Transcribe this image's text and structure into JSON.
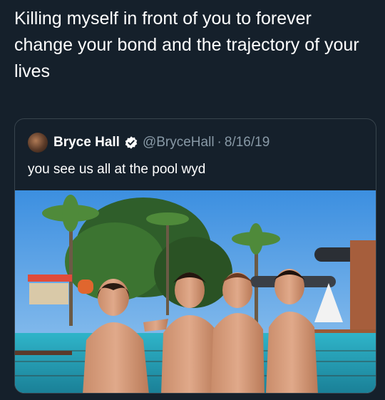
{
  "tweet": {
    "text": "Killing myself in front of you to forever change your bond and the trajectory of your lives"
  },
  "quoted_tweet": {
    "display_name": "Bryce Hall",
    "verified_icon": "verified-badge-icon",
    "handle": "@BryceHall",
    "separator": "·",
    "date": "8/16/19",
    "text": "you see us all at the pool wyd"
  },
  "colors": {
    "background": "#15202b",
    "border": "#38444d",
    "secondary_text": "#8899a6",
    "primary_text": "#ffffff"
  }
}
